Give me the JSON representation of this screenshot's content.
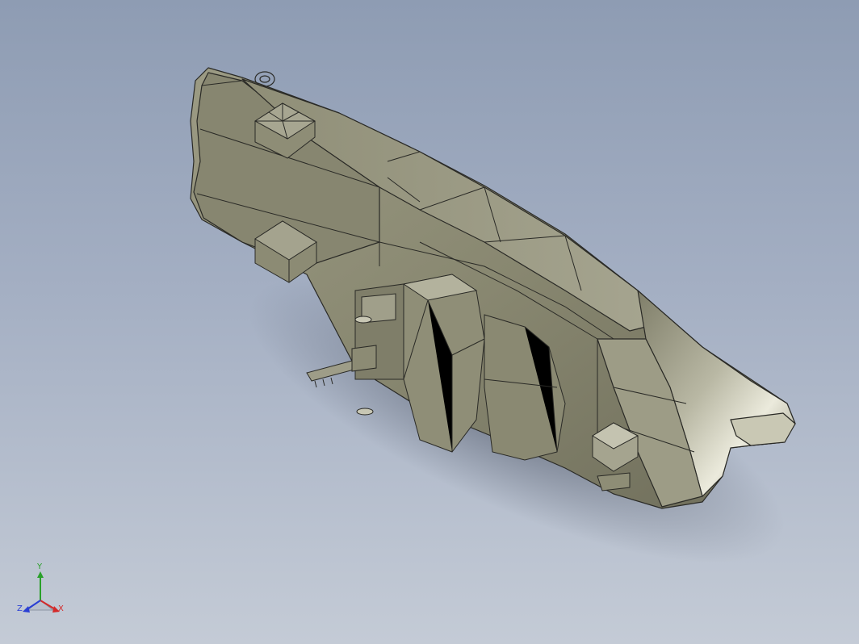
{
  "viewport": {
    "background_top": "#8e9cb3",
    "background_bottom": "#c4cbd6",
    "model_color": "#8c8b74",
    "model_highlight": "#d8d6c4",
    "model_edge": "#2a2a26"
  },
  "triad": {
    "x_label": "X",
    "y_label": "Y",
    "z_label": "Z",
    "x_color": "#d42a2a",
    "y_color": "#2aa02a",
    "z_color": "#2a3fd4"
  }
}
